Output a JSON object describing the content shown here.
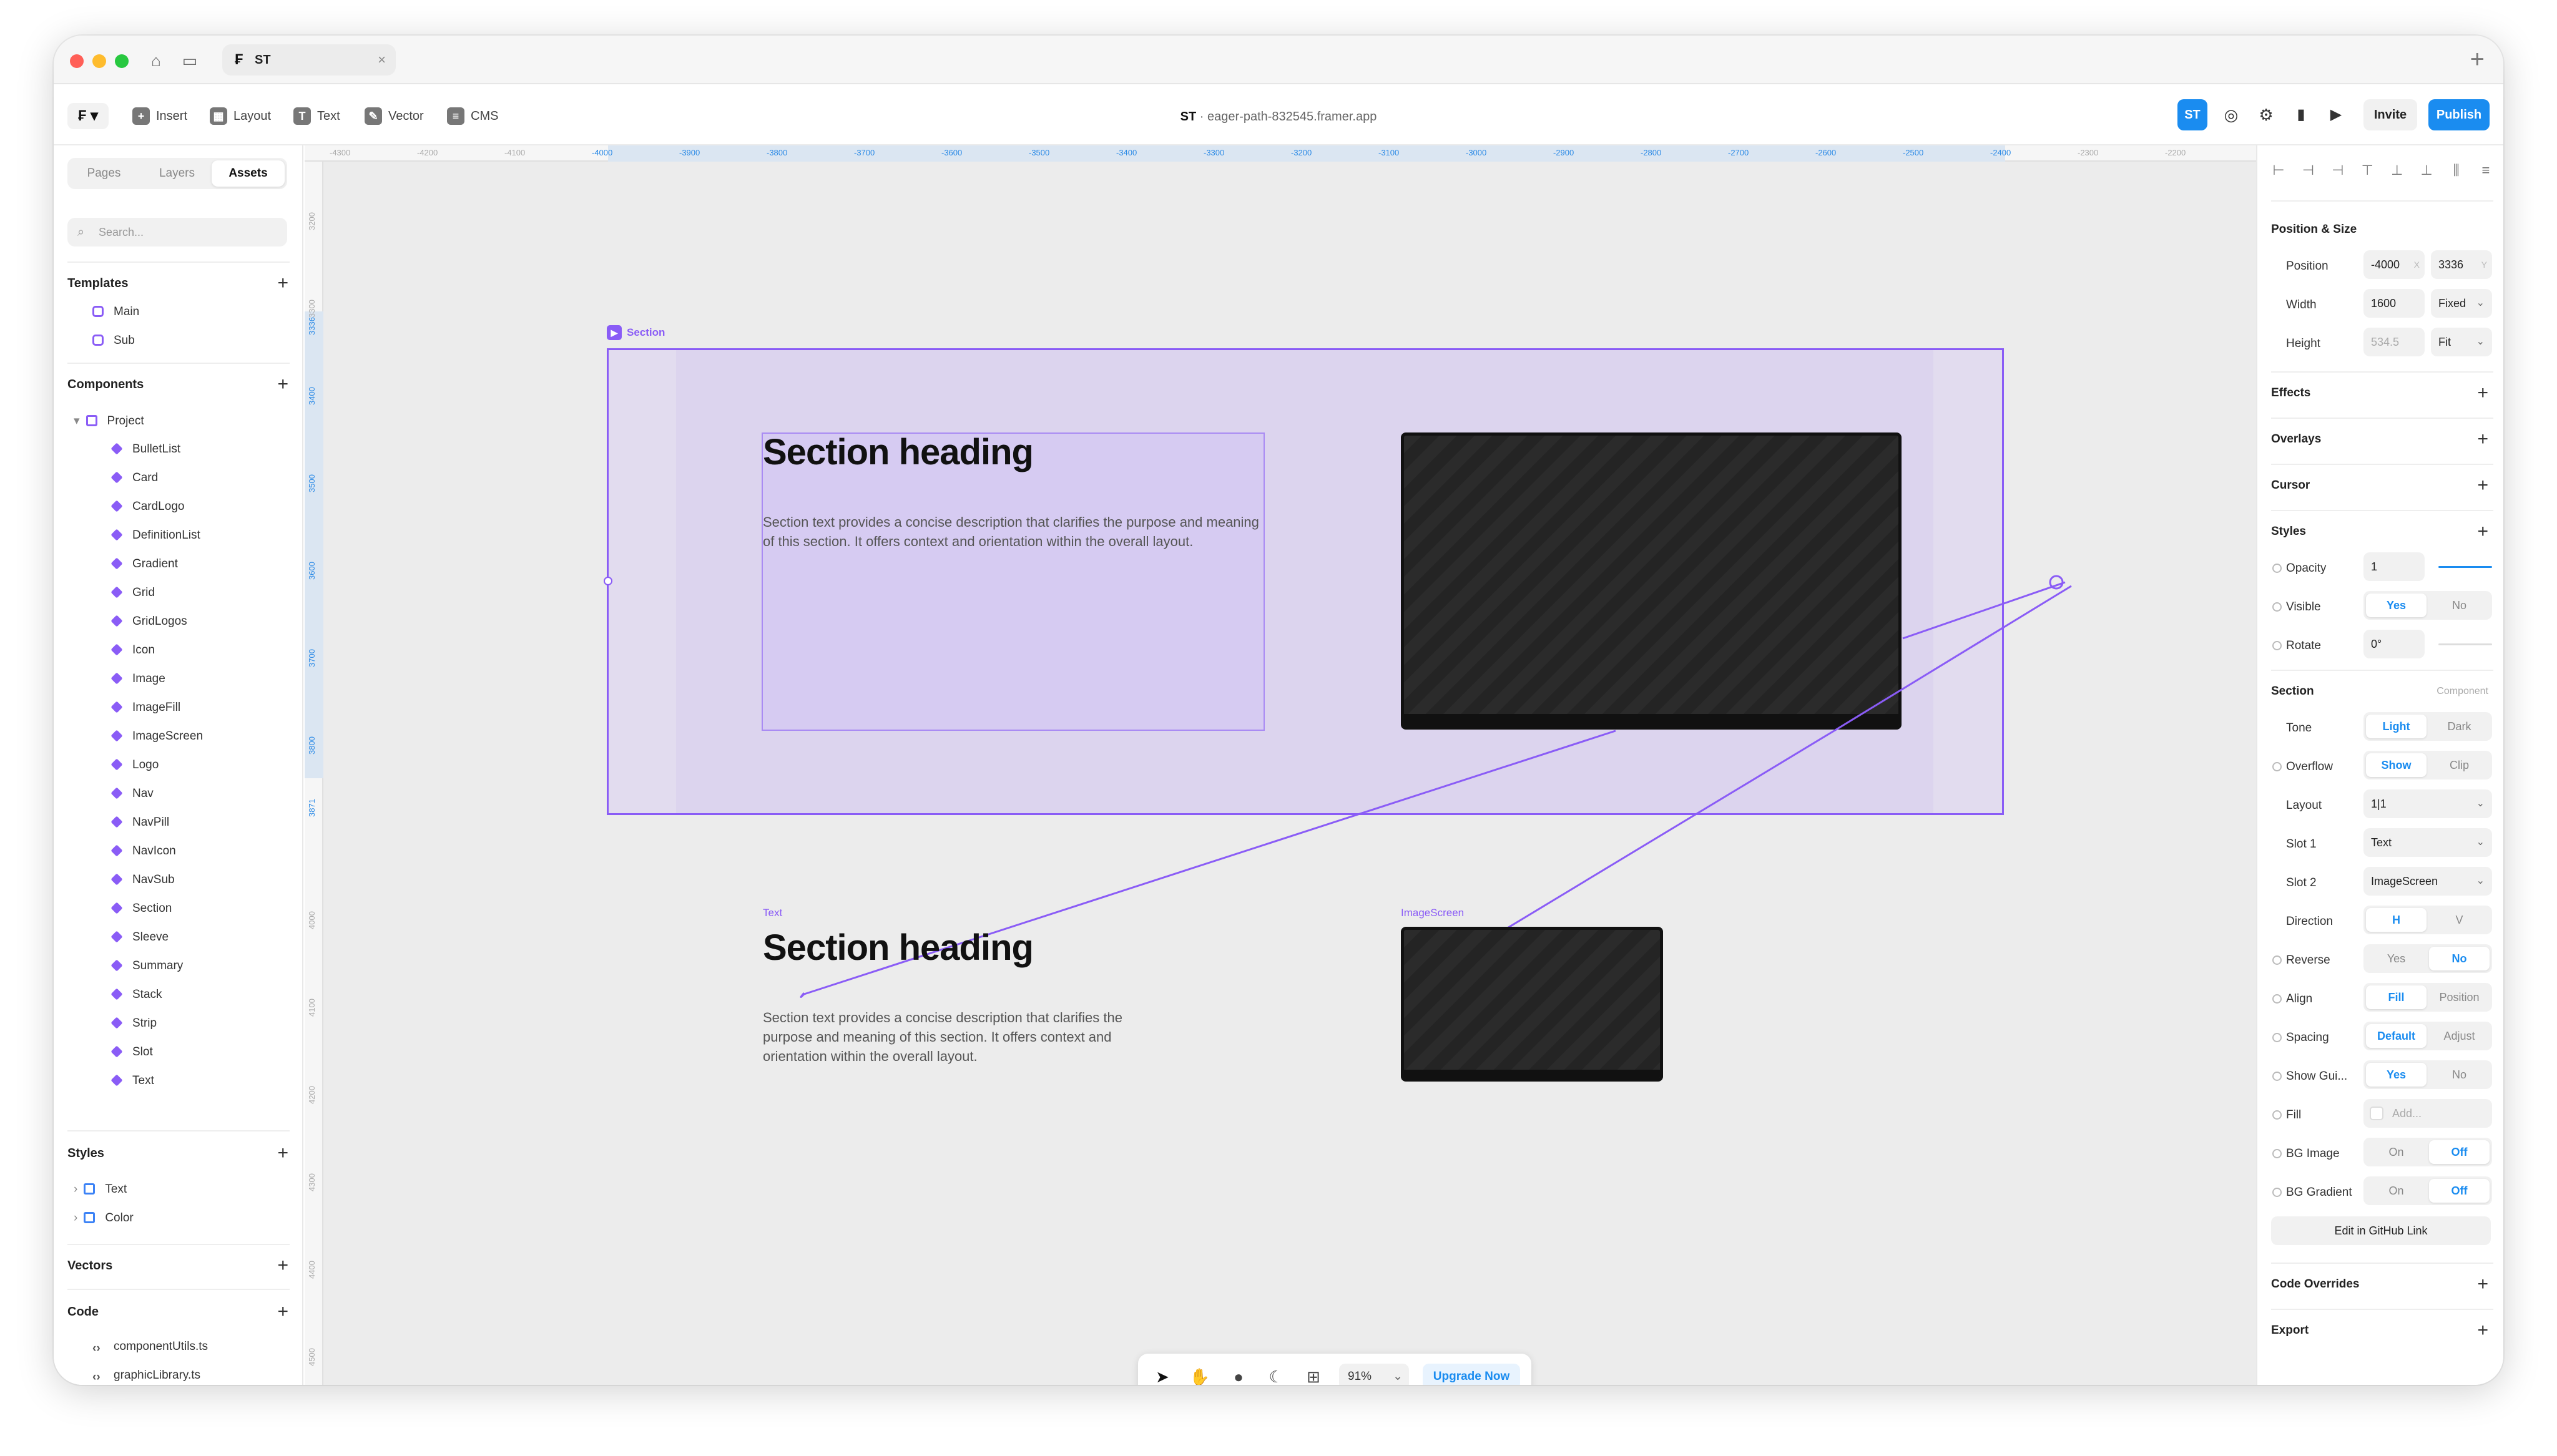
{
  "browser": {
    "tab_label": "ST",
    "tab_close": "×",
    "new_tab": "+"
  },
  "toolbar": {
    "menu_label": "₣",
    "tools": [
      {
        "label": "Insert",
        "icon": "plus-icon"
      },
      {
        "label": "Layout",
        "icon": "layout-icon"
      },
      {
        "label": "Text",
        "icon": "text-icon"
      },
      {
        "label": "Vector",
        "icon": "vector-icon"
      },
      {
        "label": "CMS",
        "icon": "cms-icon"
      }
    ],
    "doc_owner": "ST",
    "doc_separator": " · ",
    "doc_url": "eager-path-832545.framer.app",
    "avatar": "ST",
    "invite": "Invite",
    "publish": "Publish",
    "accent": "#1a8cf0"
  },
  "left": {
    "tabs": [
      "Pages",
      "Layers",
      "Assets"
    ],
    "active_tab": "Assets",
    "search_placeholder": "Search...",
    "templates_title": "Templates",
    "templates": [
      "Main",
      "Sub"
    ],
    "components_title": "Components",
    "project_folder": "Project",
    "components": [
      "BulletList",
      "Card",
      "CardLogo",
      "DefinitionList",
      "Gradient",
      "Grid",
      "GridLogos",
      "Icon",
      "Image",
      "ImageFill",
      "ImageScreen",
      "Logo",
      "Nav",
      "NavPill",
      "NavIcon",
      "NavSub",
      "Section",
      "Sleeve",
      "Summary",
      "Stack",
      "Strip",
      "Slot",
      "Text"
    ],
    "styles_title": "Styles",
    "styles": [
      "Text",
      "Color"
    ],
    "vectors_title": "Vectors",
    "code_title": "Code",
    "code_files": [
      "componentUtils.ts",
      "graphicLibrary.ts"
    ]
  },
  "canvas": {
    "ruler_x": [
      "-4300",
      "-4200",
      "-4100",
      "-4000",
      "-3900",
      "-3800",
      "-3700",
      "-3600",
      "-3500",
      "-3400",
      "-3300",
      "-3200",
      "-3100",
      "-3000",
      "-2900",
      "-2800",
      "-2700",
      "-2600",
      "-2500",
      "-2400",
      "-2300",
      "-2200"
    ],
    "ruler_y": [
      "3200",
      "3300",
      "3336",
      "3400",
      "3500",
      "3600",
      "3700",
      "3800",
      "3871",
      "4000",
      "4100",
      "4200",
      "4300",
      "4400",
      "4500"
    ],
    "section_label": "Section",
    "heading": "Section heading",
    "paragraph": "Section text provides a concise description that clarifies the purpose and meaning of this section. It offers context and orientation within the overall layout.",
    "text_label": "Text",
    "text_heading": "Section heading",
    "text_paragraph": "Section text provides a concise description that clarifies the purpose and meaning of this section. It offers context and orientation within the overall layout.",
    "imagescreen_label": "ImageScreen",
    "zoom": "91%",
    "upgrade": "Upgrade Now",
    "selection_color": "#8a5cf6"
  },
  "right": {
    "position_size_title": "Position & Size",
    "position_label": "Position",
    "position_x": "-4000",
    "position_x_suffix": "X",
    "position_y": "3336",
    "position_y_suffix": "Y",
    "width_label": "Width",
    "width_value": "1600",
    "width_mode": "Fixed",
    "height_label": "Height",
    "height_value": "534.5",
    "height_mode": "Fit",
    "effects": "Effects",
    "overlays": "Overlays",
    "cursor": "Cursor",
    "styles": "Styles",
    "opacity_label": "Opacity",
    "opacity_value": "1",
    "visible_label": "Visible",
    "visible_yes": "Yes",
    "visible_no": "No",
    "rotate_label": "Rotate",
    "rotate_value": "0°",
    "section_title": "Section",
    "section_kind": "Component",
    "tone_label": "Tone",
    "tone_light": "Light",
    "tone_dark": "Dark",
    "overflow_label": "Overflow",
    "overflow_show": "Show",
    "overflow_clip": "Clip",
    "layout_label": "Layout",
    "layout_value": "1|1",
    "slot1_label": "Slot 1",
    "slot1_value": "Text",
    "slot2_label": "Slot 2",
    "slot2_value": "ImageScreen",
    "direction_label": "Direction",
    "direction_h": "H",
    "direction_v": "V",
    "reverse_label": "Reverse",
    "reverse_yes": "Yes",
    "reverse_no": "No",
    "align_label": "Align",
    "align_fill": "Fill",
    "align_position": "Position",
    "spacing_label": "Spacing",
    "spacing_default": "Default",
    "spacing_adjust": "Adjust",
    "showgui_label": "Show Gui...",
    "showgui_yes": "Yes",
    "showgui_no": "No",
    "fill_label": "Fill",
    "fill_value": "Add...",
    "bgimage_label": "BG Image",
    "bgimage_on": "On",
    "bgimage_off": "Off",
    "bggradient_label": "BG Gradient",
    "bggradient_on": "On",
    "bggradient_off": "Off",
    "github_link": "Edit in GitHub Link",
    "code_overrides": "Code Overrides",
    "export": "Export"
  }
}
